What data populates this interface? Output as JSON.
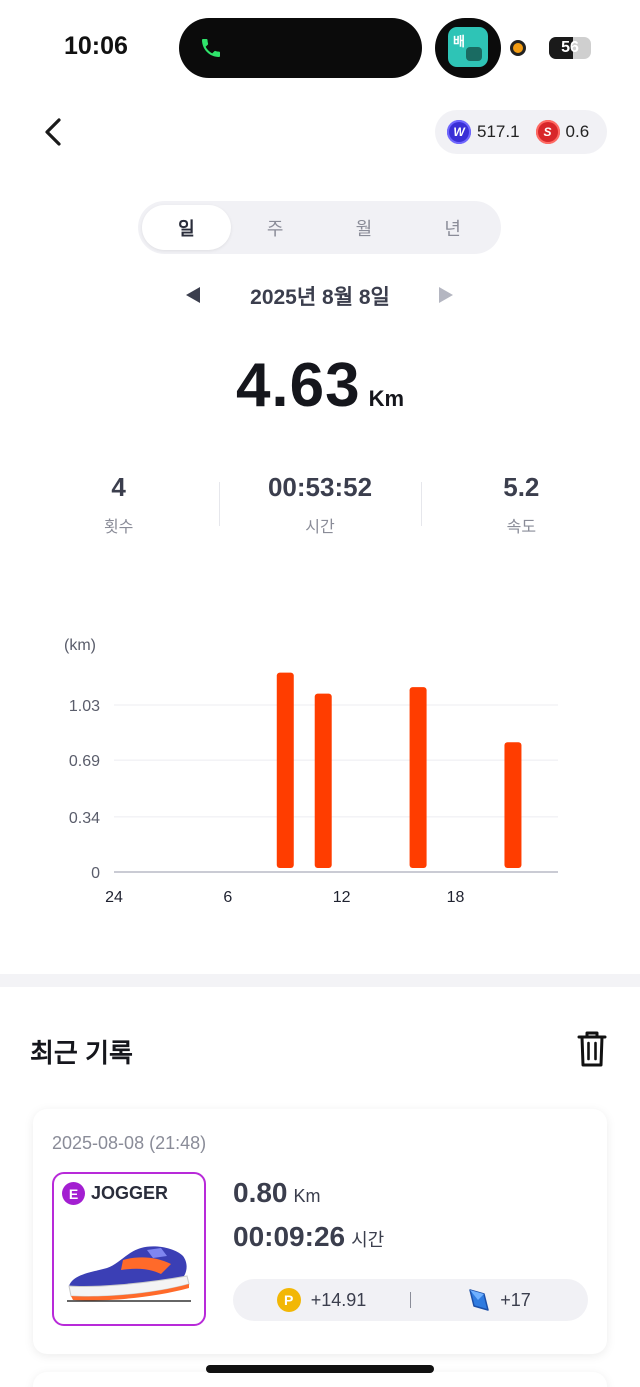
{
  "status_bar": {
    "time": "10:06",
    "battery": "56",
    "battery_level": 0.56
  },
  "header": {
    "w_points": "517.1",
    "s_points": "0.6",
    "icons": [
      "back-icon",
      "w-coin-icon",
      "s-coin-icon"
    ]
  },
  "period_tabs": [
    {
      "label": "일",
      "active": true
    },
    {
      "label": "주",
      "active": false
    },
    {
      "label": "월",
      "active": false
    },
    {
      "label": "년",
      "active": false
    }
  ],
  "date": "2025년 8월 8일",
  "total": {
    "distance": "4.63",
    "unit": "Km"
  },
  "stats": [
    {
      "value": "4",
      "label": "횟수"
    },
    {
      "value": "00:53:52",
      "label": "시간"
    },
    {
      "value": "5.2",
      "label": "속도"
    }
  ],
  "chart_data": {
    "type": "bar",
    "ylabel": "(km)",
    "y_ticks": [
      "0",
      "0.34",
      "0.69",
      "1.03"
    ],
    "x_ticks": [
      "24",
      "6",
      "12",
      "18"
    ],
    "ylim": [
      0,
      1.03
    ],
    "xlim": [
      0,
      24
    ],
    "bars": [
      {
        "hour": 9,
        "value": 1.23
      },
      {
        "hour": 11,
        "value": 1.1
      },
      {
        "hour": 16,
        "value": 1.14
      },
      {
        "hour": 21,
        "value": 0.8
      }
    ],
    "bar_color": "#ff3d00",
    "grid": true
  },
  "recent": {
    "title": "최근 기록",
    "records": [
      {
        "timestamp": "2025-08-08 (21:48)",
        "grade": "E",
        "shoe_name": "JOGGER",
        "distance": "0.80",
        "distance_unit": "Km",
        "duration": "00:09:26",
        "duration_unit": "시간",
        "reward_points": "+14.91",
        "reward_tiles": "+17"
      }
    ]
  },
  "colors": {
    "accent": "#ff3d00",
    "grade_border": "#b82ad9"
  }
}
